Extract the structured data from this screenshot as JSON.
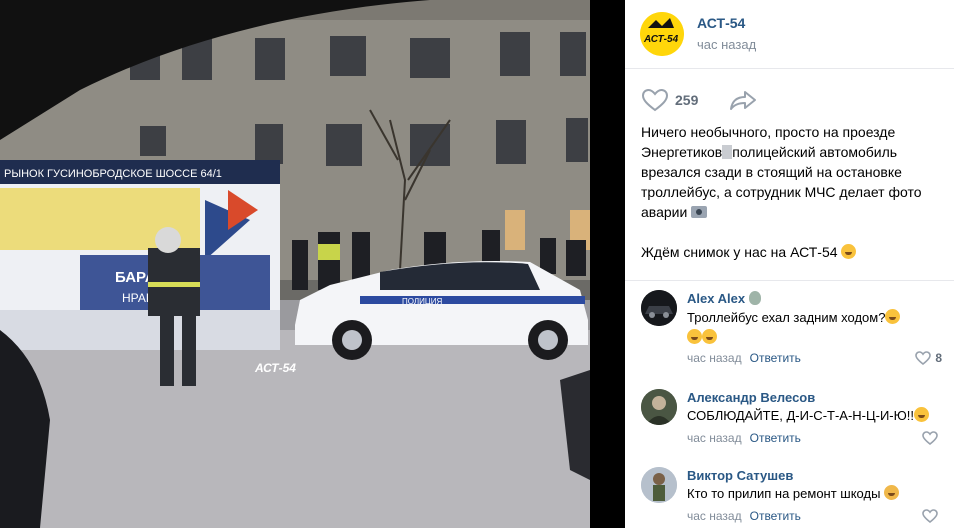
{
  "post": {
    "author": "АСТ-54",
    "time": "час назад",
    "likes": "259",
    "text_line1": "Ничего необычного, просто на проезде Энергетиков",
    "text_line2": "полицейский автомобиль врезался сзади в стоящий на остановке",
    "text_line3": "троллейбус, а сотрудник МЧС делает фото аварии",
    "text_line4": "Ждём снимок у нас на АСТ-54",
    "avatar_label": "АСТ-54"
  },
  "photo": {
    "sign_text": "РЫНОК   ГУСИНОБРОДСКОЕ ШОССЕ 64/1",
    "bus_text_1": "БАРА",
    "bus_text_2": "НРАВЫЙ",
    "police_text": "ПОЛИЦИЯ",
    "watermark": "АСТ-54"
  },
  "comments": [
    {
      "name": "Alex Alex",
      "text": "Троллейбус ехал задним ходом?",
      "time": "час назад",
      "reply": "Ответить",
      "likes": "8"
    },
    {
      "name": "Александр Велесов",
      "text": "СОБЛЮДАЙТЕ, Д-И-С-Т-А-Н-Ц-И-Ю!!",
      "time": "час назад",
      "reply": "Ответить",
      "likes": ""
    },
    {
      "name": "Виктор Сатушев",
      "text": "Кто то прилип на ремонт шкоды",
      "time": "час назад",
      "reply": "Ответить",
      "likes": ""
    }
  ],
  "colors": {
    "link": "#2a5885",
    "meta": "#818c99",
    "brand_yellow": "#ffd60a"
  }
}
